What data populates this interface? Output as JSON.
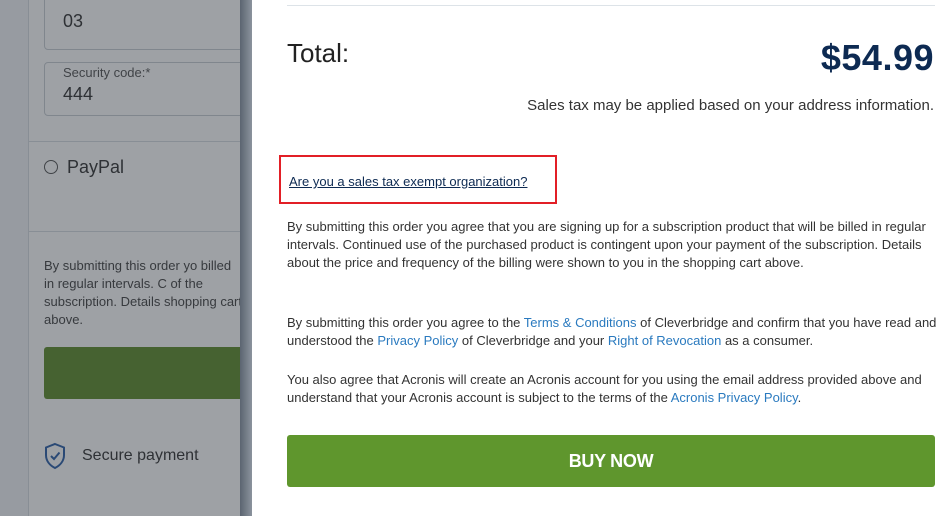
{
  "background": {
    "expiry_month_value": "03",
    "security_code_label": "Security code:*",
    "security_code_value": "444",
    "paypal_label": "PayPal",
    "terms_excerpt": "By submitting this order yo billed in regular intervals. C of the subscription. Details shopping cart above.",
    "secure_payment_label": "Secure payment"
  },
  "modal": {
    "total_label": "Total:",
    "total_value": "$54.99",
    "tax_note": "Sales tax may be applied based on your address information.",
    "exempt_link": "Are you a sales tax exempt organization?",
    "subscription_text": "By submitting this order you agree that you are signing up for a subscription product that will be billed in regular intervals. Continued use of the purchased product is contingent upon your payment of the subscription. Details about the price and frequency of the billing were shown to you in the shopping cart above.",
    "agreement": {
      "part1": "By submitting this order you agree to the ",
      "terms_link": "Terms & Conditions",
      "part2": " of Cleverbridge and confirm that you have read and understood the ",
      "privacy_link": "Privacy Policy",
      "part3": " of Cleverbridge and your ",
      "revocation_link": "Right of Revocation",
      "part4": " as a consumer."
    },
    "acronis": {
      "part1": "You also agree that Acronis will create an Acronis account for you using the email address provided above and understand that your Acronis account is subject to the terms of the ",
      "privacy_link": "Acronis Privacy Policy",
      "part2": "."
    },
    "buy_button": "BUY NOW"
  },
  "colors": {
    "total_value": "#0d2a52",
    "buy_button": "#5f962d",
    "link": "#2a7abf",
    "highlight_box": "#e21f26"
  },
  "icons": {
    "secure": "shield-check-icon"
  }
}
